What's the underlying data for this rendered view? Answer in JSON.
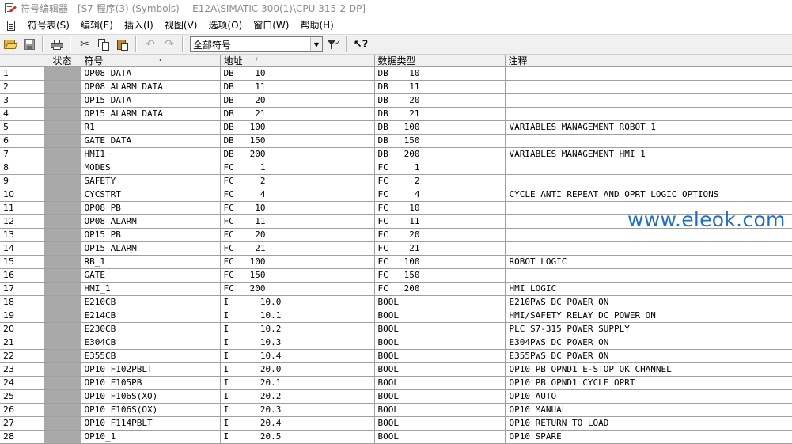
{
  "window": {
    "title": "符号编辑器 - [S7 程序(3) (Symbols) -- E12A\\SIMATIC 300(1)\\CPU 315-2 DP]"
  },
  "menu": {
    "items": [
      "符号表(S)",
      "编辑(E)",
      "插入(I)",
      "视图(V)",
      "选项(O)",
      "窗口(W)",
      "帮助(H)"
    ]
  },
  "toolbar": {
    "filter_value": "全部符号",
    "icons": [
      "open-icon",
      "save-icon",
      "print-icon",
      "cut-icon",
      "copy-icon",
      "paste-icon",
      "undo-icon",
      "redo-icon",
      "filter-icon",
      "help-icon"
    ]
  },
  "table": {
    "columns": {
      "status": "状态",
      "symbol": "符号",
      "address": "地址",
      "sort_indicator": "/",
      "data_type": "数据类型",
      "comment": "注释"
    },
    "rows": [
      {
        "n": "1",
        "symbol": "OP08 DATA",
        "address": "DB    10",
        "data_type": "DB    10",
        "comment": ""
      },
      {
        "n": "2",
        "symbol": "OP08 ALARM DATA",
        "address": "DB    11",
        "data_type": "DB    11",
        "comment": ""
      },
      {
        "n": "3",
        "symbol": "OP15 DATA",
        "address": "DB    20",
        "data_type": "DB    20",
        "comment": ""
      },
      {
        "n": "4",
        "symbol": "OP15 ALARM DATA",
        "address": "DB    21",
        "data_type": "DB    21",
        "comment": ""
      },
      {
        "n": "5",
        "symbol": "R1",
        "address": "DB   100",
        "data_type": "DB   100",
        "comment": "VARIABLES MANAGEMENT ROBOT 1"
      },
      {
        "n": "6",
        "symbol": "GATE DATA",
        "address": "DB   150",
        "data_type": "DB   150",
        "comment": ""
      },
      {
        "n": "7",
        "symbol": "HMI1",
        "address": "DB   200",
        "data_type": "DB   200",
        "comment": "VARIABLES MANAGEMENT HMI 1"
      },
      {
        "n": "8",
        "symbol": "MODES",
        "address": "FC     1",
        "data_type": "FC     1",
        "comment": ""
      },
      {
        "n": "9",
        "symbol": "SAFETY",
        "address": "FC     2",
        "data_type": "FC     2",
        "comment": ""
      },
      {
        "n": "10",
        "symbol": "CYCSTRT",
        "address": "FC     4",
        "data_type": "FC     4",
        "comment": "CYCLE ANTI REPEAT AND OPRT LOGIC OPTIONS"
      },
      {
        "n": "11",
        "symbol": "OP08 PB",
        "address": "FC    10",
        "data_type": "FC    10",
        "comment": ""
      },
      {
        "n": "12",
        "symbol": "OP08 ALARM",
        "address": "FC    11",
        "data_type": "FC    11",
        "comment": ""
      },
      {
        "n": "13",
        "symbol": "OP15 PB",
        "address": "FC    20",
        "data_type": "FC    20",
        "comment": ""
      },
      {
        "n": "14",
        "symbol": "OP15 ALARM",
        "address": "FC    21",
        "data_type": "FC    21",
        "comment": ""
      },
      {
        "n": "15",
        "symbol": "RB_1",
        "address": "FC   100",
        "data_type": "FC   100",
        "comment": "ROBOT LOGIC"
      },
      {
        "n": "16",
        "symbol": "GATE",
        "address": "FC   150",
        "data_type": "FC   150",
        "comment": ""
      },
      {
        "n": "17",
        "symbol": "HMI_1",
        "address": "FC   200",
        "data_type": "FC   200",
        "comment": "HMI LOGIC"
      },
      {
        "n": "18",
        "symbol": "E210CB",
        "address": "I      10.0",
        "data_type": "BOOL",
        "comment": "E210PWS DC POWER ON"
      },
      {
        "n": "19",
        "symbol": "E214CB",
        "address": "I      10.1",
        "data_type": "BOOL",
        "comment": "HMI/SAFETY RELAY DC POWER ON"
      },
      {
        "n": "20",
        "symbol": "E230CB",
        "address": "I      10.2",
        "data_type": "BOOL",
        "comment": "PLC S7-315 POWER SUPPLY"
      },
      {
        "n": "21",
        "symbol": "E304CB",
        "address": "I      10.3",
        "data_type": "BOOL",
        "comment": "E304PWS DC POWER ON"
      },
      {
        "n": "22",
        "symbol": "E355CB",
        "address": "I      10.4",
        "data_type": "BOOL",
        "comment": "E355PWS DC POWER ON"
      },
      {
        "n": "23",
        "symbol": "OP10 F102PBLT",
        "address": "I      20.0",
        "data_type": "BOOL",
        "comment": "OP10 PB OPND1 E-STOP OK CHANNEL"
      },
      {
        "n": "24",
        "symbol": "OP10 F105PB",
        "address": "I      20.1",
        "data_type": "BOOL",
        "comment": "OP10 PB OPND1 CYCLE OPRT"
      },
      {
        "n": "25",
        "symbol": "OP10 F106S(XO)",
        "address": "I      20.2",
        "data_type": "BOOL",
        "comment": "OP10 AUTO"
      },
      {
        "n": "26",
        "symbol": "OP10 F106S(OX)",
        "address": "I      20.3",
        "data_type": "BOOL",
        "comment": "OP10 MANUAL"
      },
      {
        "n": "27",
        "symbol": "OP10 F114PBLT",
        "address": "I      20.4",
        "data_type": "BOOL",
        "comment": "OP10 RETURN TO LOAD"
      },
      {
        "n": "28",
        "symbol": "OP10_1",
        "address": "I      20.5",
        "data_type": "BOOL",
        "comment": "OP10 SPARE"
      }
    ]
  },
  "watermark": {
    "text": "www.eleok.com",
    "color": "#1f6fc5"
  },
  "colors": {
    "status_cell": "#a9a9a9",
    "grid_line": "#a0a0a0",
    "toolbar_bg": "#f0f0f0",
    "title_text": "#8c8c8c"
  }
}
